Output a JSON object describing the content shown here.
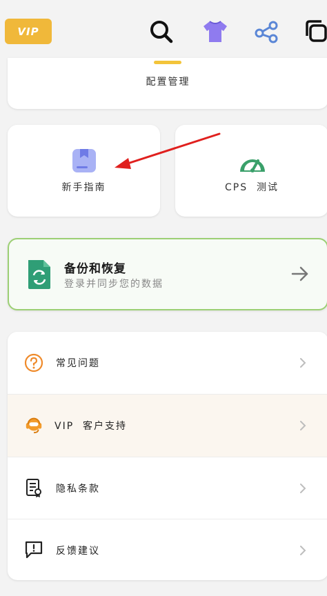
{
  "header": {
    "vip_badge": "VIP",
    "icons": [
      "search-icon",
      "tshirt-icon",
      "share-icon",
      "copy-icon"
    ]
  },
  "config": {
    "label": "配置管理"
  },
  "tiles": {
    "guide": {
      "label": "新手指南",
      "icon": "bookmark-icon"
    },
    "cps": {
      "label": "CPS  测试",
      "icon": "speedometer-icon"
    }
  },
  "backup": {
    "title": "备份和恢复",
    "subtitle": "登录并同步您的数据",
    "icon": "document-sync-icon"
  },
  "list": {
    "items": [
      {
        "label": "常见问题",
        "icon": "question-icon"
      },
      {
        "label": "VIP  客户支持",
        "icon": "headset-icon"
      },
      {
        "label": "隐私条款",
        "icon": "policy-icon"
      },
      {
        "label": "反馈建议",
        "icon": "feedback-icon"
      }
    ]
  },
  "colors": {
    "vip": "#f0b83a",
    "accent_green": "#3aa06a",
    "border_green": "#9ccf74",
    "highlight_row": "#fbf6ef",
    "annotation_red": "#e0201e"
  }
}
